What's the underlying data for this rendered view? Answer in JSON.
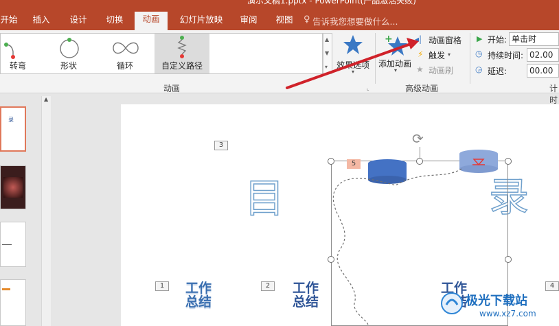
{
  "window": {
    "title": "演示文稿1.pptx - PowerPoint(产品激活失败)"
  },
  "tabs": [
    "开始",
    "插入",
    "设计",
    "切换",
    "动画",
    "幻灯片放映",
    "审阅",
    "视图"
  ],
  "active_tab": "动画",
  "tell_me": "告诉我您想要做什么...",
  "ribbon": {
    "gallery_items": [
      "转弯",
      "形状",
      "循环",
      "自定义路径"
    ],
    "effect_options": "效果选项",
    "group_animation": "动画",
    "add_animation": "添加动画",
    "animation_pane": "动画窗格",
    "trigger": "触发",
    "animation_painter": "动画刷",
    "group_advanced": "高级动画",
    "start_label": "开始:",
    "start_value": "单击时",
    "duration_label": "持续时间:",
    "duration_value": "02.00",
    "delay_label": "延迟:",
    "delay_value": "00.00",
    "group_timing": "计时"
  },
  "slide": {
    "tags": [
      "3",
      "5",
      "1",
      "2",
      "4"
    ],
    "char_mu": "目",
    "char_lu": "录",
    "work_summary": "工作\n总结"
  },
  "watermark": {
    "brand": "极光下载站",
    "url": "www.xz7.com"
  },
  "colors": {
    "accent": "#b7472a",
    "arrow": "#d0222a",
    "shape": "#4472c4"
  }
}
